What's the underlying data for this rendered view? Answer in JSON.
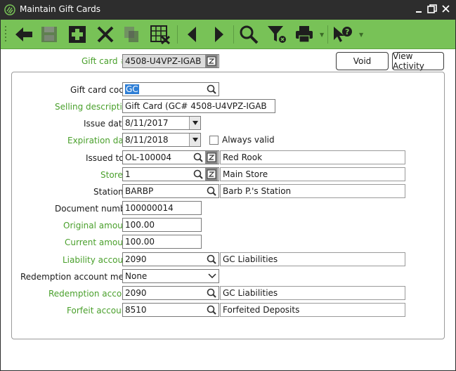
{
  "window": {
    "title": "Maintain Gift Cards",
    "controls": [
      "minimize",
      "maximize",
      "close"
    ]
  },
  "toolbar": {
    "buttons": [
      "back-arrow",
      "save",
      "add",
      "delete",
      "copy",
      "grid-delete",
      "previous",
      "next",
      "search",
      "filter",
      "print",
      "help"
    ]
  },
  "header": {
    "gift_card_label": "Gift card #",
    "gift_card_value": "4508-U4VPZ-IGAB",
    "void_label": "Void",
    "view_activity_label": "View Activity"
  },
  "form": {
    "gift_card_code": {
      "label": "Gift card code",
      "value": "GC"
    },
    "selling_description": {
      "label": "Selling description",
      "value": "Gift Card (GC# 4508-U4VPZ-IGAB"
    },
    "issue_date": {
      "label": "Issue date",
      "value": "8/11/2017"
    },
    "expiration_date": {
      "label": "Expiration date",
      "value": "8/11/2018"
    },
    "always_valid": {
      "label": "Always valid",
      "checked": false
    },
    "issued_to": {
      "label": "Issued to",
      "value": "OL-100004",
      "description": "Red Rook"
    },
    "store": {
      "label": "Store",
      "value": "1",
      "description": "Main Store"
    },
    "station": {
      "label": "Station",
      "value": "BARBP",
      "description": "Barb P.'s Station"
    },
    "document_number": {
      "label": "Document number",
      "value": "100000014"
    },
    "original_amount": {
      "label": "Original amount",
      "value": "100.00"
    },
    "current_amount": {
      "label": "Current amount",
      "value": "100.00"
    },
    "liability_account": {
      "label": "Liability account",
      "value": "2090",
      "description": "GC Liabilities"
    },
    "redemption_account_method": {
      "label": "Redemption account method",
      "value": "None"
    },
    "redemption_account": {
      "label": "Redemption account",
      "value": "2090",
      "description": "GC Liabilities"
    },
    "forfeit_account": {
      "label": "Forfeit account",
      "value": "8510",
      "description": "Forfeited Deposits"
    }
  },
  "colors": {
    "toolbar_green": "#78c257",
    "label_green": "#4aa02c",
    "titlebar": "#2d2d2d",
    "selection_blue": "#2f7fd6"
  }
}
